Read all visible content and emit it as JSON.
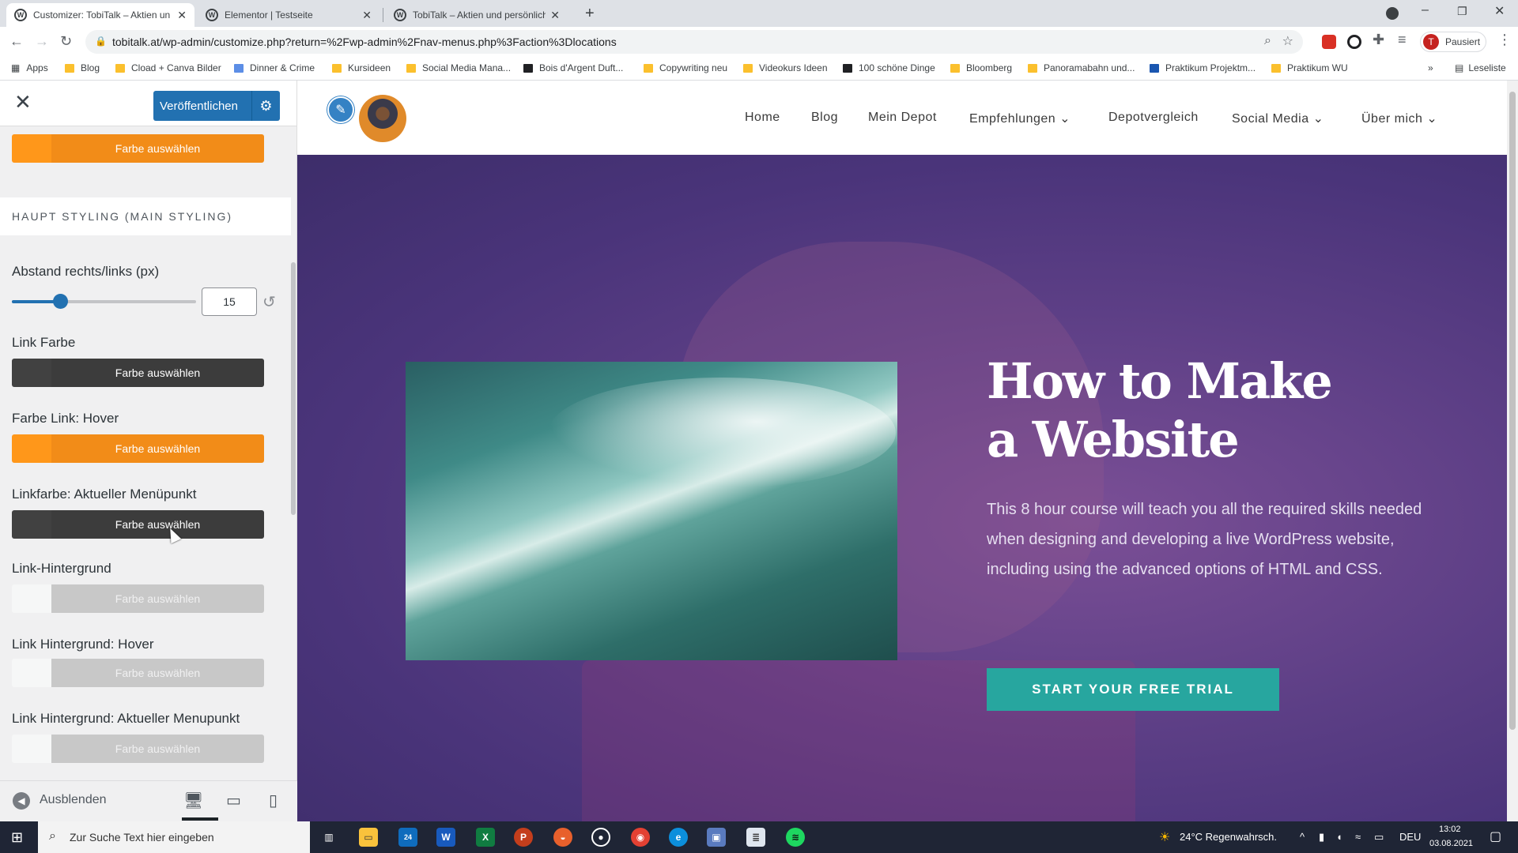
{
  "browser": {
    "tabs": [
      {
        "title": "Customizer: TobiTalk – Aktien un",
        "active": true
      },
      {
        "title": "Elementor | Testseite",
        "active": false
      },
      {
        "title": "TobiTalk – Aktien und persönliche",
        "active": false
      }
    ],
    "new_tab_glyph": "+",
    "url": "tobitalk.at/wp-admin/customize.php?return=%2Fwp-admin%2Fnav-menus.php%3Faction%3Dlocations",
    "profile_label": "Pausiert",
    "profile_initial": "T",
    "bookmarks": [
      "Apps",
      "Blog",
      "Cload + Canva Bilder",
      "Dinner & Crime",
      "Kursideen",
      "Social Media Mana...",
      "Bois d'Argent Duft...",
      "Copywriting neu",
      "Videokurs Ideen",
      "100 schöne Dinge",
      "Bloomberg",
      "Panoramabahn und...",
      "Praktikum Projektm...",
      "Praktikum WU"
    ],
    "reading_list": "Leseliste",
    "overflow": "»"
  },
  "customizer": {
    "publish_label": "Veröffentlichen",
    "section_title": "HAUPT STYLING (MAIN STYLING)",
    "spacing_label": "Abstand rechts/links (px)",
    "spacing_value": "15",
    "spacing_fraction": 0.26,
    "color_button_label": "Farbe auswählen",
    "controls": [
      {
        "label": "",
        "color": "#f28c18"
      },
      {
        "label": "Link Farbe",
        "color": "#3c3c3c"
      },
      {
        "label": "Farbe Link: Hover",
        "color": "#f28c18"
      },
      {
        "label": "Linkfarbe: Aktueller Menüpunkt",
        "color": "#3c3c3c"
      },
      {
        "label": "Link-Hintergrund",
        "color": "#c8c8c8"
      },
      {
        "label": "Link Hintergrund: Hover",
        "color": "#c8c8c8"
      },
      {
        "label": "Link Hintergrund: Aktueller Menupunkt",
        "color": "#c8c8c8"
      }
    ],
    "hide_label": "Ausblenden"
  },
  "site": {
    "nav": [
      "Home",
      "Blog",
      "Mein Depot",
      "Empfehlungen",
      "Depotvergleich",
      "Social Media",
      "Über mich"
    ],
    "nav_dropdowns": [
      false,
      false,
      false,
      true,
      false,
      true,
      true
    ],
    "hero_title": "How to Make a Website",
    "hero_text": "This 8 hour course will teach you all the required skills needed when designing and developing a live WordPress website, including using the advanced options of HTML and CSS.",
    "cta_label": "START YOUR FREE TRIAL",
    "accent": "#27a69f"
  },
  "taskbar": {
    "search_placeholder": "Zur Suche Text hier eingeben",
    "weather": "24°C  Regenwahrsch.",
    "language": "DEU",
    "time": "13:02",
    "date": "03.08.2021",
    "mail_badge": "24"
  }
}
